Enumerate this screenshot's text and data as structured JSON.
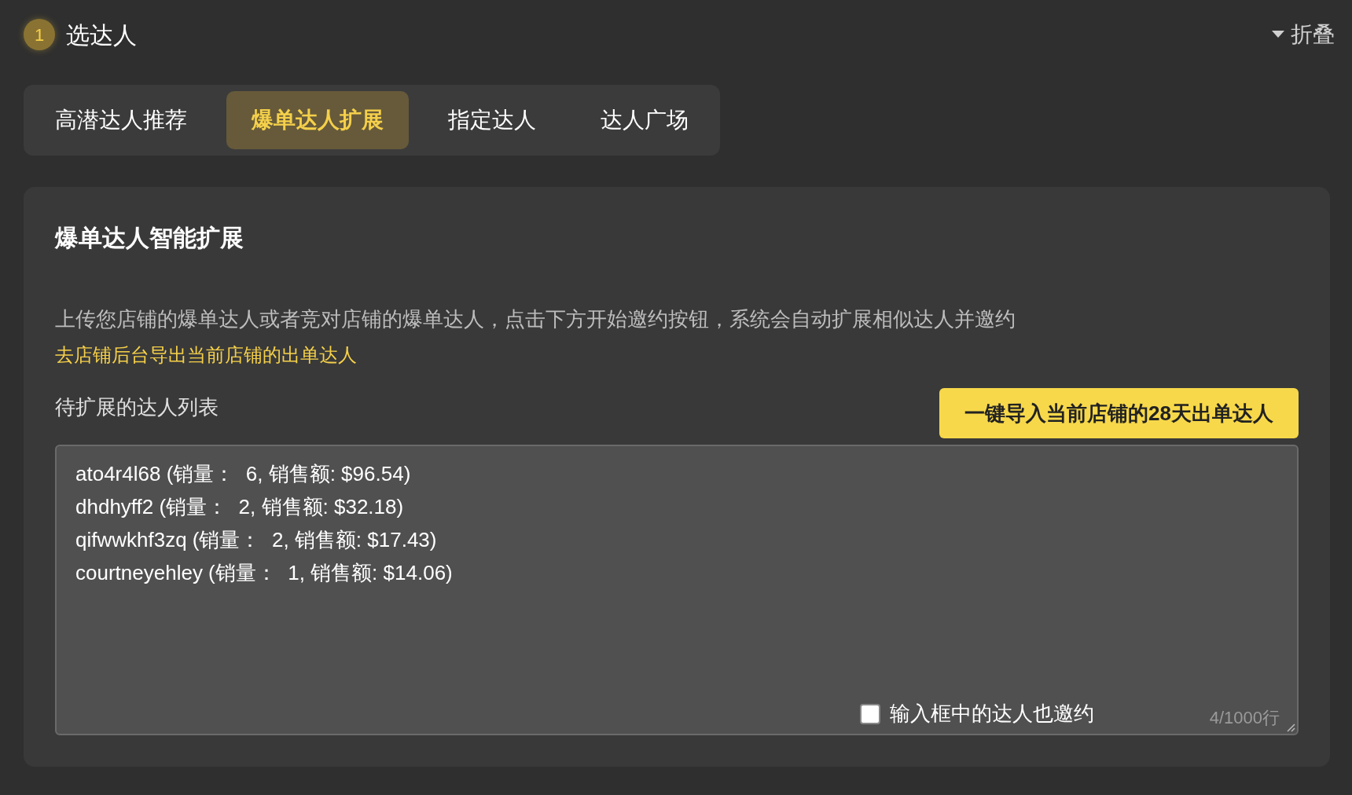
{
  "step": {
    "number": "1",
    "title": "选达人",
    "collapse": "折叠"
  },
  "tabs": [
    {
      "label": "高潜达人推荐",
      "selected": false
    },
    {
      "label": "爆单达人扩展",
      "selected": true
    },
    {
      "label": "指定达人",
      "selected": false
    },
    {
      "label": "达人广场",
      "selected": false
    }
  ],
  "panel": {
    "title": "爆单达人智能扩展",
    "description": "上传您店铺的爆单达人或者竞对店铺的爆单达人，点击下方开始邀约按钮，系统会自动扩展相似达人并邀约",
    "link": "去店铺后台导出当前店铺的出单达人",
    "list_label": "待扩展的达人列表",
    "import_button": "一键导入当前店铺的28天出单达人",
    "textarea": {
      "value": "ato4r4l68 (销量：  6, 销售额: $96.54)\ndhdhyff2 (销量：  2, 销售额: $32.18)\nqifwwkhf3zq (销量：  2, 销售额: $17.43)\ncourtneyehley (销量：  1, 销售额: $14.06)"
    },
    "invite_checkbox": {
      "label": "输入框中的达人也邀约",
      "checked": false
    },
    "line_count": "4/1000行"
  }
}
